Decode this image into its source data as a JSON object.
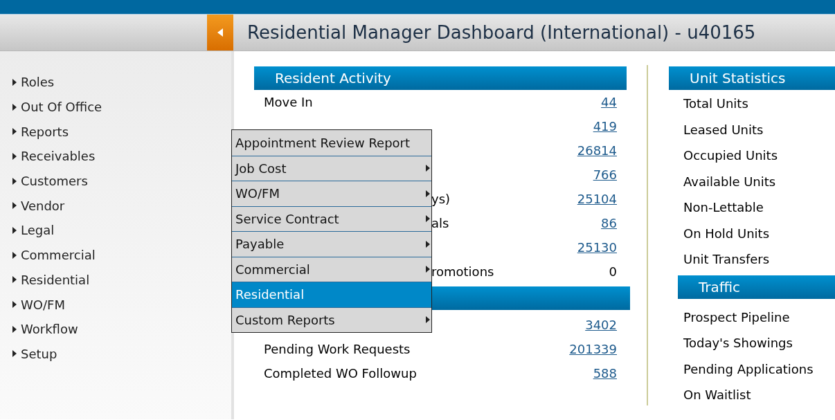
{
  "header": {
    "title": "Residential Manager Dashboard (International) - u40165"
  },
  "sidebar": {
    "items": [
      {
        "label": "Roles"
      },
      {
        "label": "Out Of Office"
      },
      {
        "label": "Reports"
      },
      {
        "label": "Receivables"
      },
      {
        "label": "Customers"
      },
      {
        "label": "Vendor"
      },
      {
        "label": "Legal"
      },
      {
        "label": "Commercial"
      },
      {
        "label": "Residential"
      },
      {
        "label": "WO/FM"
      },
      {
        "label": "Workflow"
      },
      {
        "label": "Setup"
      }
    ]
  },
  "sections": [
    {
      "title": "Resident Activity",
      "rows": [
        {
          "label": "Move In",
          "covered": false,
          "value": "44",
          "kind": "link"
        },
        {
          "value": "419",
          "kind": "link"
        },
        {
          "value": "26814",
          "kind": "link"
        },
        {
          "value": "766",
          "kind": "link"
        },
        {
          "label": "ys)",
          "covered": true,
          "value": "25104",
          "kind": "link"
        },
        {
          "label": "als",
          "covered": true,
          "value": "86",
          "kind": "link"
        },
        {
          "value": "25130",
          "kind": "link"
        },
        {
          "label": "romotions",
          "covered": true,
          "value": "0",
          "kind": "plain"
        }
      ]
    },
    {
      "rows": [
        {
          "value": "3402",
          "kind": "link"
        },
        {
          "label": "Pending Work Requests",
          "covered": false,
          "value": "201339",
          "kind": "link"
        },
        {
          "label": "Completed WO Followup",
          "covered": false,
          "value": "588",
          "kind": "link"
        }
      ]
    }
  ],
  "right_sections": [
    {
      "title": "Unit Statistics",
      "rows": [
        "Total Units",
        "Leased Units",
        "Occupied Units",
        "Available Units",
        "Non-Lettable",
        "On Hold Units",
        "Unit Transfers"
      ]
    },
    {
      "title": "Traffic",
      "rows": [
        "Prospect Pipeline",
        "Today's Showings",
        "Pending Applications",
        "On Waitlist"
      ]
    }
  ],
  "menu": {
    "items": [
      {
        "label": "Appointment Review Report",
        "submenu": false,
        "selected": false
      },
      {
        "label": "Job Cost",
        "submenu": true,
        "selected": false
      },
      {
        "label": "WO/FM",
        "submenu": true,
        "selected": false
      },
      {
        "label": "Service Contract",
        "submenu": true,
        "selected": false
      },
      {
        "label": "Payable",
        "submenu": true,
        "selected": false
      },
      {
        "label": "Commercial",
        "submenu": true,
        "selected": false
      },
      {
        "label": "Residential",
        "submenu": false,
        "selected": true
      },
      {
        "label": "Custom Reports",
        "submenu": true,
        "selected": false
      }
    ]
  }
}
